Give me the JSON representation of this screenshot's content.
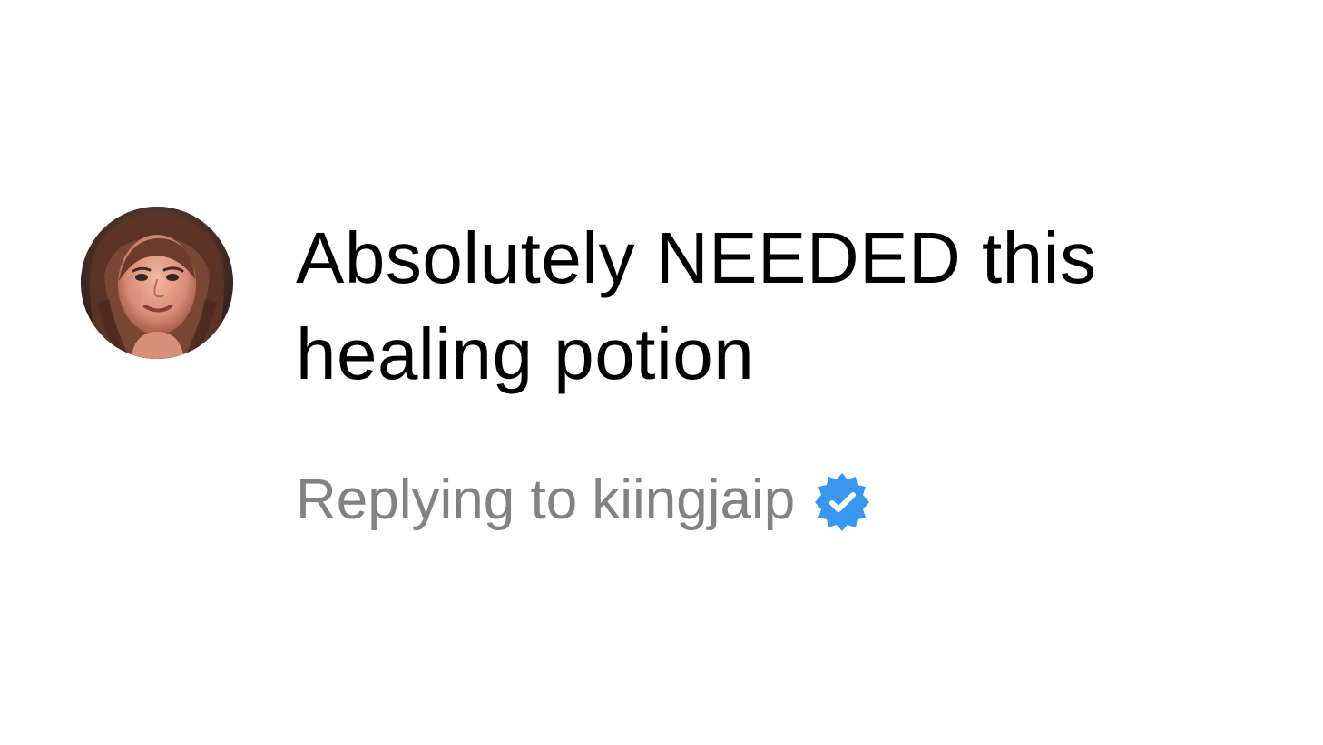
{
  "comment": {
    "text": "Absolutely NEEDED this healing potion",
    "avatar_icon": "user-avatar-photo"
  },
  "reply": {
    "prefix": "Replying to",
    "username": "kiingjaip",
    "verified_icon": "verified-badge-icon",
    "verified_color": "#3897f0"
  },
  "colors": {
    "background": "#ffffff",
    "comment_text": "#000000",
    "reply_text": "#828282"
  }
}
